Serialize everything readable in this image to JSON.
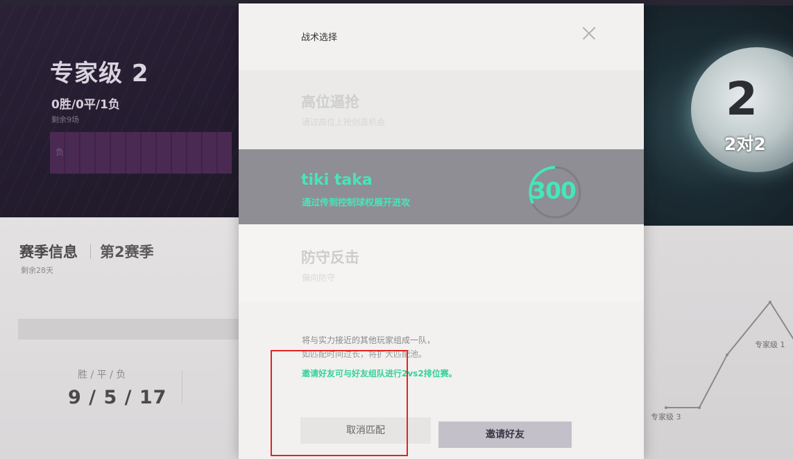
{
  "background": {
    "rank": {
      "title": "专家级 2",
      "record": "0胜/0平/1负",
      "remaining": "剩余9场",
      "bar_label": "负"
    },
    "season": {
      "title": "赛季信息",
      "name": "第2赛季",
      "remaining": "剩余28天",
      "wdl_label": "胜 / 平 / 负",
      "wdl_value": "9 / 5 / 17"
    },
    "mode": {
      "number": "2",
      "label": "2对2"
    },
    "chart_data": {
      "type": "line",
      "categories": [
        "",
        "",
        "",
        "",
        ""
      ],
      "labels": [
        "专家级 3",
        "专家级 1"
      ],
      "series": [
        {
          "values": [
            3,
            3,
            2,
            1,
            2
          ]
        }
      ]
    }
  },
  "modal": {
    "title": "战术选择",
    "tactics": [
      {
        "name": "高位逼抢",
        "desc": "通过高位上抢创造机会"
      },
      {
        "name": "tiki taka",
        "desc": "通过传到控制球权展开进攻",
        "cost": "300"
      },
      {
        "name": "防守反击",
        "desc": "偏向防守"
      }
    ],
    "info": {
      "line1": "将与实力接近的其他玩家组成一队，",
      "line2": "如匹配时间过长，将扩大匹配池。",
      "green": "邀请好友可与好友组队进行2vs2排位赛。"
    },
    "buttons": {
      "cancel": "取消匹配",
      "invite": "邀请好友"
    }
  },
  "colors": {
    "accent_green": "#47e6b8",
    "selected_bg": "#8e8e94",
    "highlight": "#e22222"
  }
}
